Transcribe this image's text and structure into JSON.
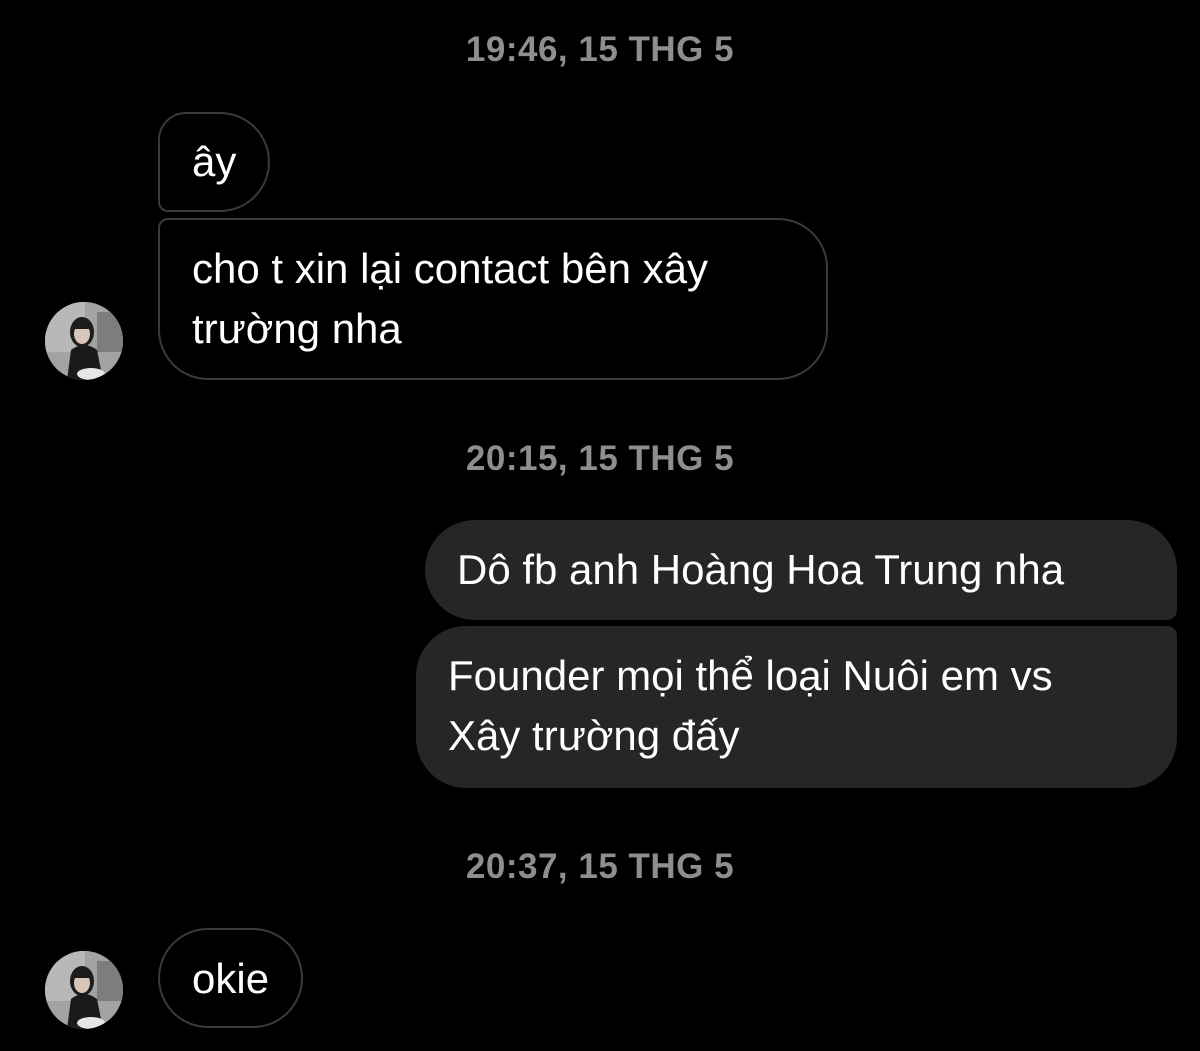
{
  "conversation": {
    "timestamps": [
      "19:46, 15 THG 5",
      "20:15, 15 THG 5",
      "20:37, 15 THG 5"
    ],
    "messages": [
      {
        "sender": "other",
        "text": "ây"
      },
      {
        "sender": "other",
        "text": "cho t xin lại contact bên xây\ntrường nha"
      },
      {
        "sender": "me",
        "text": "Dô fb anh Hoàng Hoa Trung nha"
      },
      {
        "sender": "me",
        "text": "Founder mọi thể loại Nuôi em vs\nXây trường đấy"
      },
      {
        "sender": "other",
        "text": "okie"
      }
    ],
    "avatar_icon": "user-avatar-photo"
  },
  "colors": {
    "background": "#000000",
    "timestamp": "#8e8e8e",
    "incoming_border": "#3a3a3a",
    "outgoing_fill": "#262626",
    "text": "#ffffff"
  }
}
